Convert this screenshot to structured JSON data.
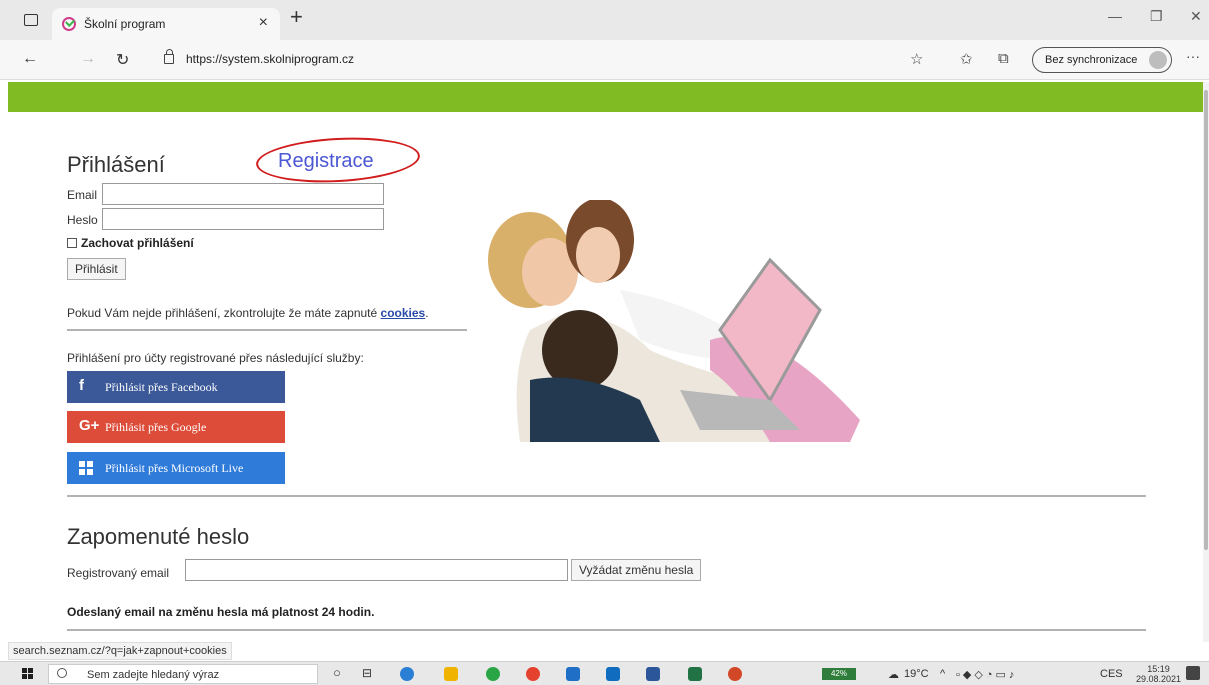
{
  "browser": {
    "tab_title": "Školní program",
    "url": "https://system.skolniprogram.cz",
    "sync_label": "Bez synchronizace",
    "icons": [
      "tab-menu-icon",
      "close-icon",
      "new-tab-icon",
      "minimize-icon",
      "restore-icon",
      "window-close-icon",
      "back-icon",
      "forward-icon",
      "refresh-icon",
      "lock-icon",
      "read-aloud-icon",
      "favorites-icon",
      "collections-icon",
      "profile-avatar-icon",
      "more-icon"
    ]
  },
  "brand": {
    "accent": "#80bb24",
    "link": "#4b57d4",
    "annotation": "#d11d1d"
  },
  "login": {
    "title": "Přihlášení",
    "register_link": "Registrace",
    "email_label": "Email",
    "email_value": "",
    "password_label": "Heslo",
    "password_value": "",
    "remember_label": "Zachovat přihlášení",
    "remember_checked": false,
    "submit_label": "Přihlásit",
    "cookies_note": "Pokud Vám nejde přihlášení, zkontrolujte že máte zapnuté",
    "cookies_link": "cookies",
    "cookies_end": "."
  },
  "social": {
    "intro": "Přihlášení pro účty registrované přes následující služby:",
    "facebook": {
      "label": "Přihlásit přes Facebook",
      "color": "#3b5998"
    },
    "google": {
      "label": "Přihlásit přes Google",
      "icon_text": "G+",
      "color": "#dd4b39"
    },
    "microsoft": {
      "label": "Přihlásit přes Microsoft Live",
      "color": "#2f7bd9"
    }
  },
  "forgot": {
    "title": "Zapomenuté heslo",
    "email_label": "Registrovaný email",
    "email_value": "",
    "submit_label": "Vyžádat změnu hesla",
    "note": "Odeslaný email na změnu hesla má platnost 24 hodin."
  },
  "status_url": "search.seznam.cz/?q=jak+zapnout+cookies",
  "taskbar": {
    "search_placeholder": "Sem zadejte hledaný výraz",
    "battery": "42%",
    "weather": "19°C",
    "language": "CES",
    "time": "15:19",
    "date": "29.08.2021"
  }
}
